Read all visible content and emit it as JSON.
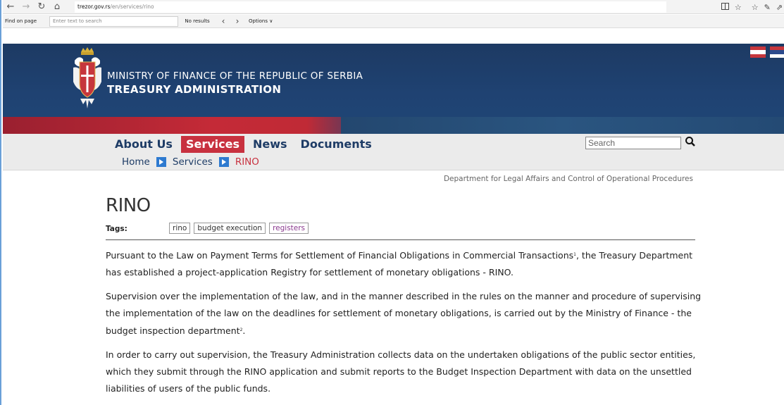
{
  "browser": {
    "url_host": "trezor.gov.rs",
    "url_path": "/en/services/rino",
    "back_glyph": "←",
    "forward_glyph": "→",
    "refresh_glyph": "↻",
    "home_glyph": "⌂",
    "icons": [
      "reading-view-icon",
      "favorite-star-icon",
      "favorites-hub-icon",
      "pen-icon",
      "share-icon"
    ]
  },
  "find_bar": {
    "label": "Find on page",
    "placeholder": "Enter text to search",
    "result": "No results",
    "prev_glyph": "‹",
    "next_glyph": "›",
    "options": "Options ∨"
  },
  "header": {
    "ministry": "MINISTRY OF FINANCE OF THE REPUBLIC OF SERBIA",
    "treasury": "TREASURY ADMINISTRATION",
    "flags": [
      "english-flag-icon",
      "serbian-flag-icon"
    ],
    "colors": {
      "header_blue": "#1f4272",
      "accent_red": "#c8313f"
    }
  },
  "nav": {
    "items": [
      {
        "label": "About Us",
        "active": false
      },
      {
        "label": "Services",
        "active": true
      },
      {
        "label": "News",
        "active": false
      },
      {
        "label": "Documents",
        "active": false
      }
    ],
    "search_placeholder": "Search"
  },
  "breadcrumb": {
    "home": "Home",
    "services": "Services",
    "current": "RINO"
  },
  "content": {
    "department": "Department for Legal Affairs and Control of Operational Procedures",
    "title": "RINO",
    "tags_label": "Tags:",
    "tags": [
      "rino",
      "budget execution",
      "registers"
    ],
    "p1_text": "Pursuant to the Law on Payment Terms for Settlement of Financial Obligations in Commercial Transactions",
    "p1_sup": "1",
    "p1_text2": ", the Treasury Department has established a project-application Registry for settlement of monetary obligations - RINO.",
    "p2_text": "Supervision over the implementation of the law, and in the manner described in the rules on the manner and procedure of supervising the implementation of the law on the deadlines for settlement of monetary obligations, is carried out by the Ministry of Finance - the budget inspection department",
    "p2_sup": "2",
    "p2_text2": ".",
    "p3_text": "In order to carry out supervision, the Treasury Administration collects data on the undertaken obligations of the public sector entities, which they submit through the RINO application and submit reports to the Budget Inspection Department with data on the unsettled liabilities of users of the public funds."
  }
}
